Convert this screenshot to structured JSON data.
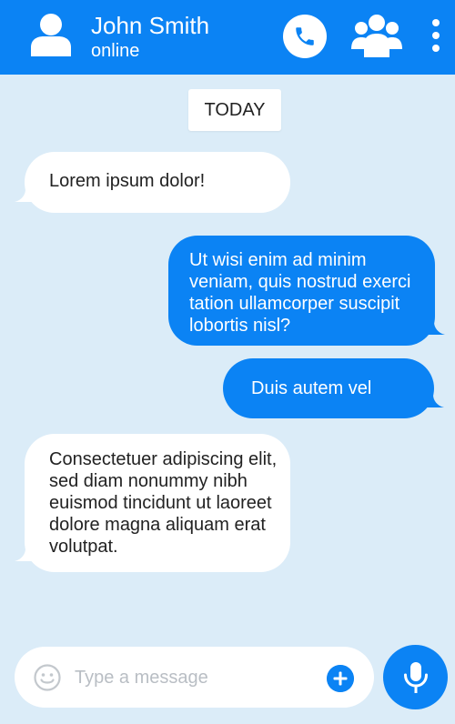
{
  "header": {
    "contact_name": "John Smith",
    "contact_status": "online",
    "avatar_icon": "user-avatar-icon",
    "call_icon": "phone-icon",
    "group_icon": "group-icon",
    "menu_icon": "more-vertical-icon"
  },
  "date_separator": "TODAY",
  "messages": [
    {
      "direction": "incoming",
      "lines": [
        "Lorem ipsum dolor!"
      ]
    },
    {
      "direction": "outgoing",
      "lines": [
        "Ut wisi enim ad minim",
        "veniam, quis nostrud exerci",
        "tation ullamcorper suscipit",
        "lobortis nisl?"
      ]
    },
    {
      "direction": "outgoing",
      "lines": [
        "Duis autem vel"
      ]
    },
    {
      "direction": "incoming",
      "lines": [
        "Consectetuer adipiscing elit,",
        "sed diam nonummy nibh",
        "euismod tincidunt ut laoreet",
        "dolore magna aliquam erat",
        "volutpat."
      ]
    }
  ],
  "composer": {
    "placeholder": "Type a message",
    "value": "",
    "emoji_icon": "emoji-icon",
    "add_icon": "plus-icon",
    "mic_icon": "microphone-icon"
  },
  "colors": {
    "accent": "#0b83f4",
    "background": "#dbecf8",
    "incoming_bubble": "#ffffff",
    "text": "#222222",
    "placeholder": "#b9bec4"
  }
}
